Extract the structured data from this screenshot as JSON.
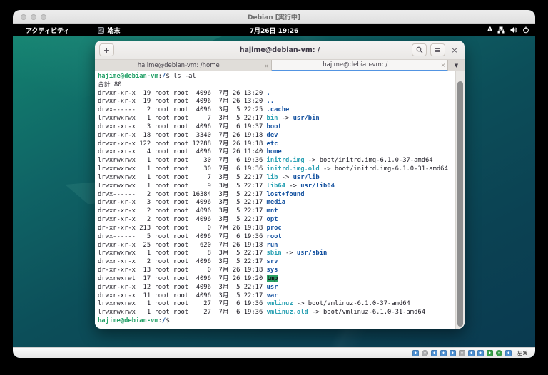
{
  "window": {
    "title": "Debian [実行中]"
  },
  "topbar": {
    "activities_label": "アクティビティ",
    "app_label": "端末",
    "app_icon_glyph": ">_",
    "clock": "7月26日 19:26",
    "input_method": "A"
  },
  "terminal": {
    "header_title": "hajime@debian-vm: /",
    "icons": {
      "new_tab": "+",
      "menu": "≡",
      "close": "×",
      "tab_close": "×",
      "tab_list": "▼"
    },
    "tabs": [
      {
        "label": "hajime@debian-vm: /home",
        "active": false
      },
      {
        "label": "hajime@debian-vm: /",
        "active": true
      }
    ],
    "colors": {
      "background": "#ffffff",
      "foreground": "#1c1a23",
      "prompt_green": "#26a269",
      "directory_blue": "#1552a0",
      "symlink_cyan": "#2aa1b3",
      "tmp_highlight_bg": "#2aa264",
      "active_tab_accent": "#5294e2"
    },
    "lines": [
      [
        [
          "g",
          "hajime@debian-vm"
        ],
        [
          "f",
          ":"
        ],
        [
          "b",
          "/"
        ],
        [
          "f",
          "$ ls -al"
        ]
      ],
      [
        [
          "f",
          "合計 80"
        ]
      ],
      [
        [
          "f",
          "drwxr-xr-x  19 root root  4096  7月 26 13:20 "
        ],
        [
          "b",
          "."
        ]
      ],
      [
        [
          "f",
          "drwxr-xr-x  19 root root  4096  7月 26 13:20 "
        ],
        [
          "b",
          ".."
        ]
      ],
      [
        [
          "f",
          "drwx------   2 root root  4096  3月  5 22:25 "
        ],
        [
          "b",
          ".cache"
        ]
      ],
      [
        [
          "f",
          "lrwxrwxrwx   1 root root     7  3月  5 22:17 "
        ],
        [
          "c",
          "bin"
        ],
        [
          "f",
          " -> "
        ],
        [
          "b",
          "usr/bin"
        ]
      ],
      [
        [
          "f",
          "drwxr-xr-x   3 root root  4096  7月  6 19:37 "
        ],
        [
          "b",
          "boot"
        ]
      ],
      [
        [
          "f",
          "drwxr-xr-x  18 root root  3340  7月 26 19:18 "
        ],
        [
          "b",
          "dev"
        ]
      ],
      [
        [
          "f",
          "drwxr-xr-x 122 root root 12288  7月 26 19:18 "
        ],
        [
          "b",
          "etc"
        ]
      ],
      [
        [
          "f",
          "drwxr-xr-x   4 root root  4096  7月 26 11:40 "
        ],
        [
          "b",
          "home"
        ]
      ],
      [
        [
          "f",
          "lrwxrwxrwx   1 root root    30  7月  6 19:36 "
        ],
        [
          "c",
          "initrd.img"
        ],
        [
          "f",
          " -> boot/initrd.img-6.1.0-37-amd64"
        ]
      ],
      [
        [
          "f",
          "lrwxrwxrwx   1 root root    30  7月  6 19:36 "
        ],
        [
          "c",
          "initrd.img.old"
        ],
        [
          "f",
          " -> boot/initrd.img-6.1.0-31-amd64"
        ]
      ],
      [
        [
          "f",
          "lrwxrwxrwx   1 root root     7  3月  5 22:17 "
        ],
        [
          "c",
          "lib"
        ],
        [
          "f",
          " -> "
        ],
        [
          "b",
          "usr/lib"
        ]
      ],
      [
        [
          "f",
          "lrwxrwxrwx   1 root root     9  3月  5 22:17 "
        ],
        [
          "c",
          "lib64"
        ],
        [
          "f",
          " -> "
        ],
        [
          "b",
          "usr/lib64"
        ]
      ],
      [
        [
          "f",
          "drwx------   2 root root 16384  3月  5 22:17 "
        ],
        [
          "b",
          "lost+found"
        ]
      ],
      [
        [
          "f",
          "drwxr-xr-x   3 root root  4096  3月  5 22:17 "
        ],
        [
          "b",
          "media"
        ]
      ],
      [
        [
          "f",
          "drwxr-xr-x   2 root root  4096  3月  5 22:17 "
        ],
        [
          "b",
          "mnt"
        ]
      ],
      [
        [
          "f",
          "drwxr-xr-x   2 root root  4096  3月  5 22:17 "
        ],
        [
          "b",
          "opt"
        ]
      ],
      [
        [
          "f",
          "dr-xr-xr-x 213 root root     0  7月 26 19:18 "
        ],
        [
          "b",
          "proc"
        ]
      ],
      [
        [
          "f",
          "drwx------   5 root root  4096  7月  6 19:36 "
        ],
        [
          "b",
          "root"
        ]
      ],
      [
        [
          "f",
          "drwxr-xr-x  25 root root   620  7月 26 19:18 "
        ],
        [
          "b",
          "run"
        ]
      ],
      [
        [
          "f",
          "lrwxrwxrwx   1 root root     8  3月  5 22:17 "
        ],
        [
          "c",
          "sbin"
        ],
        [
          "f",
          " -> "
        ],
        [
          "b",
          "usr/sbin"
        ]
      ],
      [
        [
          "f",
          "drwxr-xr-x   2 root root  4096  3月  5 22:17 "
        ],
        [
          "b",
          "srv"
        ]
      ],
      [
        [
          "f",
          "dr-xr-xr-x  13 root root     0  7月 26 19:18 "
        ],
        [
          "b",
          "sys"
        ]
      ],
      [
        [
          "f",
          "drwxrwxrwt  17 root root  4096  7月 26 19:20 "
        ],
        [
          "t",
          "tmp"
        ]
      ],
      [
        [
          "f",
          "drwxr-xr-x  12 root root  4096  3月  5 22:17 "
        ],
        [
          "b",
          "usr"
        ]
      ],
      [
        [
          "f",
          "drwxr-xr-x  11 root root  4096  3月  5 22:17 "
        ],
        [
          "b",
          "var"
        ]
      ],
      [
        [
          "f",
          "lrwxrwxrwx   1 root root    27  7月  6 19:36 "
        ],
        [
          "c",
          "vmlinuz"
        ],
        [
          "f",
          " -> boot/vmlinuz-6.1.0-37-amd64"
        ]
      ],
      [
        [
          "f",
          "lrwxrwxrwx   1 root root    27  7月  6 19:36 "
        ],
        [
          "c",
          "vmlinuz.old"
        ],
        [
          "f",
          " -> boot/vmlinuz-6.1.0-31-amd64"
        ]
      ],
      [
        [
          "g",
          "hajime@debian-vm"
        ],
        [
          "f",
          ":"
        ],
        [
          "b",
          "/"
        ],
        [
          "f",
          "$ "
        ]
      ]
    ]
  },
  "statusbar": {
    "host_key": "左⌘",
    "icons": [
      {
        "name": "hdd-icon",
        "color": "#4d8fd1",
        "shape": "square"
      },
      {
        "name": "optical-disk-icon",
        "color": "#a9abae",
        "shape": "circle"
      },
      {
        "name": "audio-icon",
        "color": "#4d8fd1",
        "shape": "square"
      },
      {
        "name": "network-adapter-icon",
        "color": "#4d8fd1",
        "shape": "square"
      },
      {
        "name": "usb-icon",
        "color": "#4d8fd1",
        "shape": "square"
      },
      {
        "name": "shared-folders-icon",
        "color": "#a9abae",
        "shape": "square"
      },
      {
        "name": "display-icon",
        "color": "#4d8fd1",
        "shape": "square"
      },
      {
        "name": "recording-icon",
        "color": "#4d8fd1",
        "shape": "square"
      },
      {
        "name": "features-icon",
        "color": "#38a04a",
        "shape": "square"
      },
      {
        "name": "processor-icon",
        "color": "#38a04a",
        "shape": "circle"
      },
      {
        "name": "mouse-integration-icon",
        "color": "#4d8fd1",
        "shape": "square"
      }
    ]
  }
}
